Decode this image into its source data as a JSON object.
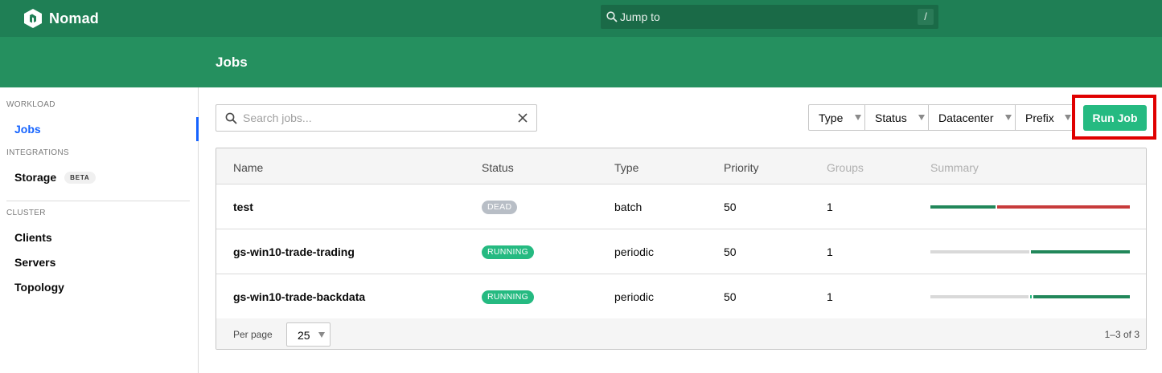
{
  "app": {
    "brand": "Nomad"
  },
  "jump": {
    "placeholder": "Jump to",
    "shortcut": "/"
  },
  "subnav": {
    "title": "Jobs"
  },
  "sidebar": {
    "sections": [
      {
        "label": "WORKLOAD",
        "items": [
          {
            "label": "Jobs",
            "active": true
          }
        ]
      },
      {
        "label": "INTEGRATIONS",
        "items": [
          {
            "label": "Storage",
            "badge": "BETA"
          }
        ]
      },
      {
        "label": "CLUSTER",
        "items": [
          {
            "label": "Clients"
          },
          {
            "label": "Servers"
          },
          {
            "label": "Topology"
          }
        ]
      }
    ]
  },
  "toolbar": {
    "search_placeholder": "Search jobs...",
    "filters": [
      "Type",
      "Status",
      "Datacenter",
      "Prefix"
    ],
    "run_job_label": "Run Job"
  },
  "table": {
    "columns": [
      "Name",
      "Status",
      "Type",
      "Priority",
      "Groups",
      "Summary"
    ],
    "rows": [
      {
        "name": "test",
        "status": "DEAD",
        "type": "batch",
        "priority": "50",
        "groups": "1",
        "summary": [
          {
            "status": "complete",
            "fraction": 0.33
          },
          {
            "status": "failed",
            "fraction": 0.67
          }
        ]
      },
      {
        "name": "gs-win10-trade-trading",
        "status": "RUNNING",
        "type": "periodic",
        "priority": "50",
        "groups": "1",
        "summary": [
          {
            "status": "queued",
            "fraction": 0.5
          },
          {
            "status": "running",
            "fraction": 0.5
          }
        ]
      },
      {
        "name": "gs-win10-trade-backdata",
        "status": "RUNNING",
        "type": "periodic",
        "priority": "50",
        "groups": "1",
        "summary": [
          {
            "status": "queued",
            "fraction": 0.5
          },
          {
            "status": "starting",
            "fraction": 0.01
          },
          {
            "status": "running",
            "fraction": 0.49
          }
        ]
      }
    ],
    "footer": {
      "per_page_label": "Per page",
      "per_page_value": "25",
      "range": "1–3 of 3"
    }
  },
  "colors": {
    "topbar": "#1f7f55",
    "subnav": "#25905f",
    "accent_blue": "#1563ff",
    "complete": "#21875a",
    "failed": "#c73b3b",
    "running": "#21875a",
    "queued": "#d9d9d9",
    "starting": "#25ba81",
    "highlight": "#e00000"
  }
}
